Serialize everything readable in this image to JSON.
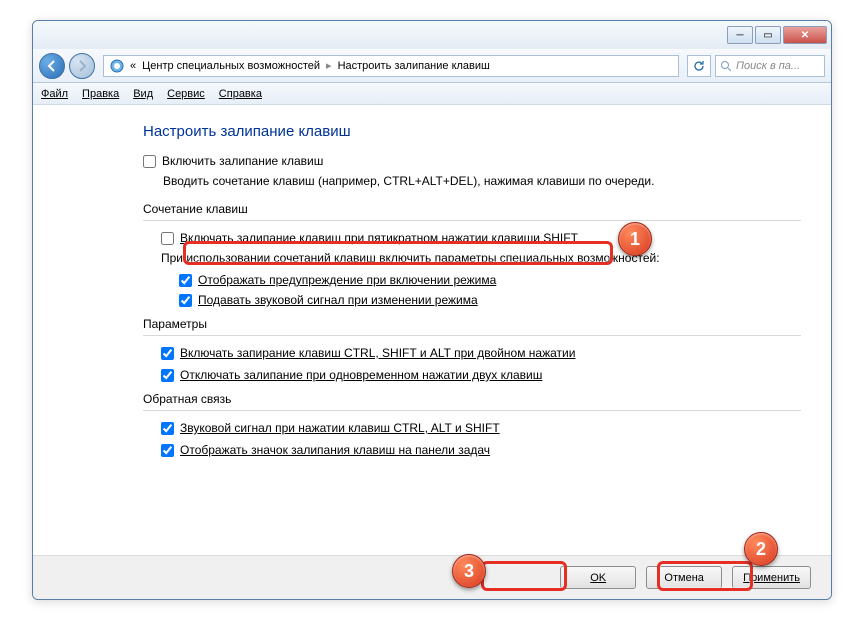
{
  "titlebar": {
    "min_glyph": "─",
    "max_glyph": "▭",
    "close_glyph": "✕"
  },
  "nav": {
    "breadcrumb_prefix": "«",
    "breadcrumb_item1": "Центр специальных возможностей",
    "breadcrumb_sep": "▸",
    "breadcrumb_item2": "Настроить залипание клавиш",
    "search_placeholder": "Поиск в па..."
  },
  "menu": {
    "file": "Файл",
    "edit": "Правка",
    "view": "Вид",
    "tools": "Сервис",
    "help": "Справка"
  },
  "page": {
    "title": "Настроить залипание клавиш",
    "enable_sticky_label": "Включить залипание клавиш",
    "enable_sticky_desc": "Вводить сочетание клавиш (например, CTRL+ALT+DEL), нажимая клавиши по очереди.",
    "section1_title": "Сочетание клавиш",
    "opt_shift5": "Включать залипание клавиш при пятикратном нажатии клавиши SHIFT",
    "opt_shift5_sub": "При использовании сочетаний клавиш включить параметры специальных возможностей:",
    "opt_warn": "Отображать предупреждение при включении режима",
    "opt_sound": "Подавать звуковой сигнал при изменении режима",
    "section2_title": "Параметры",
    "opt_lock": "Включать запирание клавиш CTRL, SHIFT и ALT при двойном нажатии",
    "opt_unlock": "Отключать залипание при одновременном нажатии двух клавиш",
    "section3_title": "Обратная связь",
    "opt_beep": "Звуковой сигнал при нажатии клавиш CTRL, ALT и SHIFT",
    "opt_tray": "Отображать значок залипания клавиш на панели задач"
  },
  "buttons": {
    "ok": "OK",
    "cancel": "Отмена",
    "apply": "Применить"
  },
  "annotations": {
    "a1": "1",
    "a2": "2",
    "a3": "3"
  }
}
